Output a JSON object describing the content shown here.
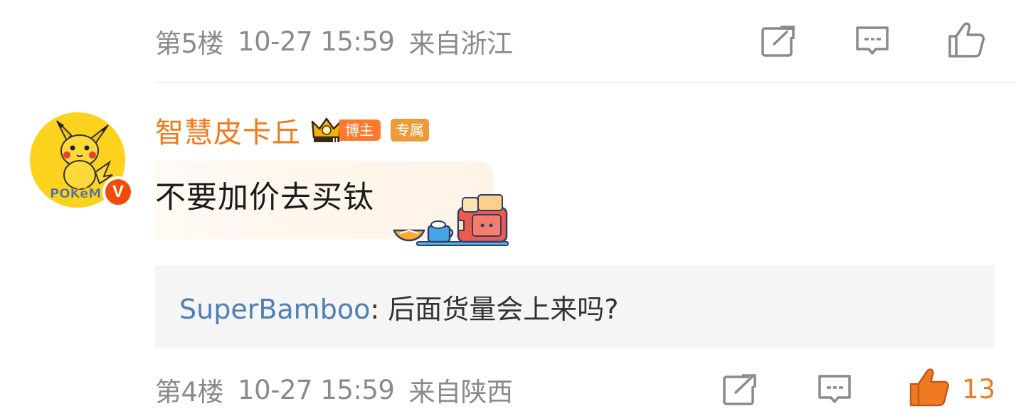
{
  "floor5": {
    "floor": "第5楼",
    "time": "10-27 15:59",
    "location": "来自浙江",
    "icons": [
      "share-icon",
      "comment-icon",
      "like-icon"
    ]
  },
  "comment": {
    "username": "智慧皮卡丘",
    "badge_blogger": "博主",
    "badge_exclusive": "专属",
    "text": "不要加价去买钛",
    "avatar_text": "POKéMON",
    "verified_mark": "V"
  },
  "reply": {
    "user": "SuperBamboo",
    "separator": ":",
    "text": " 后面货量会上来吗?"
  },
  "floor4": {
    "floor": "第4楼",
    "time": "10-27 15:59",
    "location": "来自陕西",
    "like_count": "13"
  },
  "colors": {
    "username": "#ef7a1a",
    "reply_user": "#4f7fb4",
    "meta": "#8a8a8a",
    "like_active": "#f07a22"
  }
}
